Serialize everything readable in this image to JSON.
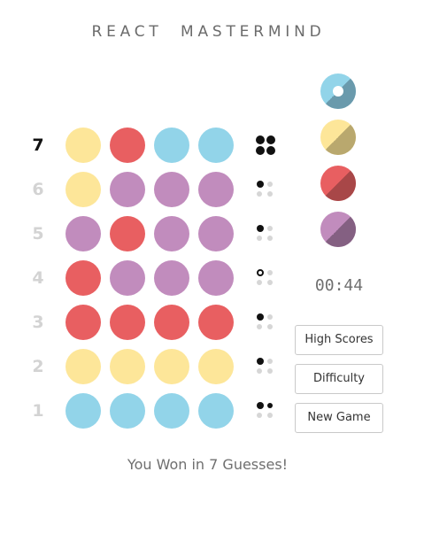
{
  "app": {
    "title": "REACT  MASTERMIND"
  },
  "colors": {
    "yellow": "#FDE699",
    "red": "#E85F61",
    "blue": "#92D4E9",
    "purple": "#C18CBD"
  },
  "picker_colors": [
    {
      "name": "blue",
      "light": "#92D4E9",
      "dark": "#6A9AAC",
      "selected": true
    },
    {
      "name": "yellow",
      "light": "#FDE699",
      "dark": "#B9A86E",
      "selected": false
    },
    {
      "name": "red",
      "light": "#E85F61",
      "dark": "#A84748",
      "selected": false
    },
    {
      "name": "purple",
      "light": "#C18CBD",
      "dark": "#846082",
      "selected": false
    }
  ],
  "guesses": [
    {
      "number": "7",
      "current": true,
      "pegs": [
        "yellow",
        "red",
        "blue",
        "blue"
      ],
      "scores": [
        "black",
        "black",
        "black",
        "black"
      ]
    },
    {
      "number": "6",
      "current": false,
      "pegs": [
        "yellow",
        "purple",
        "purple",
        "purple"
      ],
      "scores": [
        "black",
        "empty",
        "empty",
        "empty"
      ]
    },
    {
      "number": "5",
      "current": false,
      "pegs": [
        "purple",
        "red",
        "purple",
        "purple"
      ],
      "scores": [
        "black",
        "empty",
        "empty",
        "empty"
      ]
    },
    {
      "number": "4",
      "current": false,
      "pegs": [
        "red",
        "purple",
        "purple",
        "purple"
      ],
      "scores": [
        "white",
        "empty",
        "empty",
        "empty"
      ]
    },
    {
      "number": "3",
      "current": false,
      "pegs": [
        "red",
        "red",
        "red",
        "red"
      ],
      "scores": [
        "black",
        "empty",
        "empty",
        "empty"
      ]
    },
    {
      "number": "2",
      "current": false,
      "pegs": [
        "yellow",
        "yellow",
        "yellow",
        "yellow"
      ],
      "scores": [
        "black",
        "empty",
        "empty",
        "empty"
      ]
    },
    {
      "number": "1",
      "current": false,
      "pegs": [
        "blue",
        "blue",
        "blue",
        "blue"
      ],
      "scores": [
        "black",
        "black",
        "empty",
        "empty"
      ]
    }
  ],
  "timer": "00:44",
  "buttons": {
    "high_scores": "High Scores",
    "difficulty": "Difficulty",
    "new_game": "New Game"
  },
  "message": "You Won in 7 Guesses!"
}
